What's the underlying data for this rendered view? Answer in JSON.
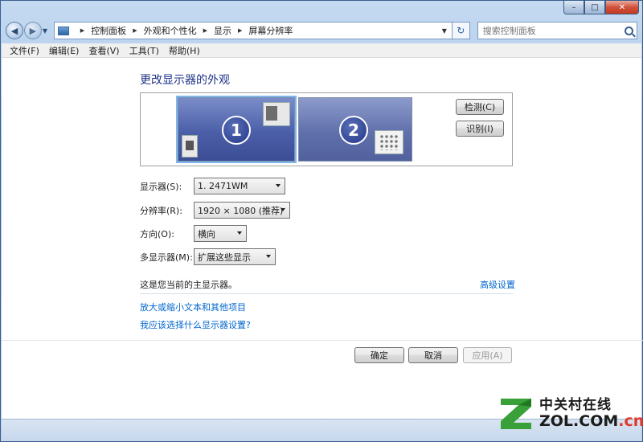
{
  "window": {
    "caption_buttons": {
      "minimize": "–",
      "maximize": "□",
      "close": "✕"
    }
  },
  "navigation": {
    "back_glyph": "◀",
    "forward_glyph": "▶",
    "breadcrumbs": [
      "控制面板",
      "外观和个性化",
      "显示",
      "屏幕分辨率"
    ],
    "address_icon": "control-panel-icon",
    "refresh_glyph": "↻",
    "search_placeholder": "搜索控制面板"
  },
  "menu": [
    "文件(F)",
    "编辑(E)",
    "查看(V)",
    "工具(T)",
    "帮助(H)"
  ],
  "main": {
    "title": "更改显示器的外观",
    "monitors": [
      {
        "number": "1",
        "selected": true
      },
      {
        "number": "2",
        "selected": false
      }
    ],
    "detect_button": "检测(C)",
    "identify_button": "识别(I)",
    "settings": {
      "display": {
        "label": "显示器(S):",
        "value": "1. 2471WM"
      },
      "resolution": {
        "label": "分辨率(R):",
        "value": "1920 × 1080 (推荐)"
      },
      "orientation": {
        "label": "方向(O):",
        "value": "横向"
      },
      "multi_display": {
        "label": "多显示器(M):",
        "value": "扩展这些显示"
      }
    },
    "primary_note": "这是您当前的主显示器。",
    "advanced_link": "高级设置",
    "links": [
      "放大或缩小文本和其他项目",
      "我应该选择什么显示器设置?"
    ]
  },
  "footer_buttons": {
    "ok": "确定",
    "cancel": "取消",
    "apply": "应用(A)"
  },
  "watermark": {
    "brand": "中关村在线",
    "url_main": "ZOL.COM",
    "url_suffix": ".cn"
  },
  "colors": {
    "title_blue": "#1e3287",
    "link_blue": "#0066cc",
    "monitor_blue": "#4b5fa8",
    "watermark_red": "#e03a2a"
  }
}
